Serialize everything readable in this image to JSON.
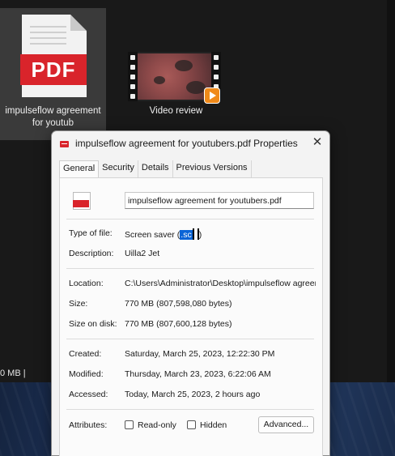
{
  "desktop": {
    "pdf_icon": {
      "badge": "PDF",
      "label": "impulseflow agreement for youtub"
    },
    "video_icon": {
      "label": "Video review"
    },
    "status_fragment": "0 MB  |"
  },
  "dialog": {
    "title": "impulseflow agreement for youtubers.pdf Properties",
    "close_glyph": "✕",
    "tabs": [
      "General",
      "Security",
      "Details",
      "Previous Versions"
    ],
    "filename": "impulseflow agreement for youtubers.pdf",
    "type_of_file": {
      "label": "Type of file:",
      "value": "Screen saver (",
      "ext": ".sc",
      "close": ")"
    },
    "description": {
      "label": "Description:",
      "value": "Uilla2 Jet"
    },
    "location": {
      "label": "Location:",
      "value": "C:\\Users\\Administrator\\Desktop\\impulseflow agreem"
    },
    "size": {
      "label": "Size:",
      "value": "770 MB (807,598,080 bytes)"
    },
    "size_on_disk": {
      "label": "Size on disk:",
      "value": "770 MB (807,600,128 bytes)"
    },
    "created": {
      "label": "Created:",
      "value": "Saturday, March 25, 2023, 12:22:30 PM"
    },
    "modified": {
      "label": "Modified:",
      "value": "Thursday, March 23, 2023, 6:22:06 AM"
    },
    "accessed": {
      "label": "Accessed:",
      "value": "Today, March 25, 2023, 2 hours ago"
    },
    "attributes": {
      "label": "Attributes:",
      "read_only": "Read-only",
      "hidden": "Hidden",
      "advanced": "Advanced..."
    }
  },
  "colors": {
    "pdf_red": "#d9242b",
    "selection_blue": "#0a64d6",
    "desktop_bg": "#191919"
  }
}
